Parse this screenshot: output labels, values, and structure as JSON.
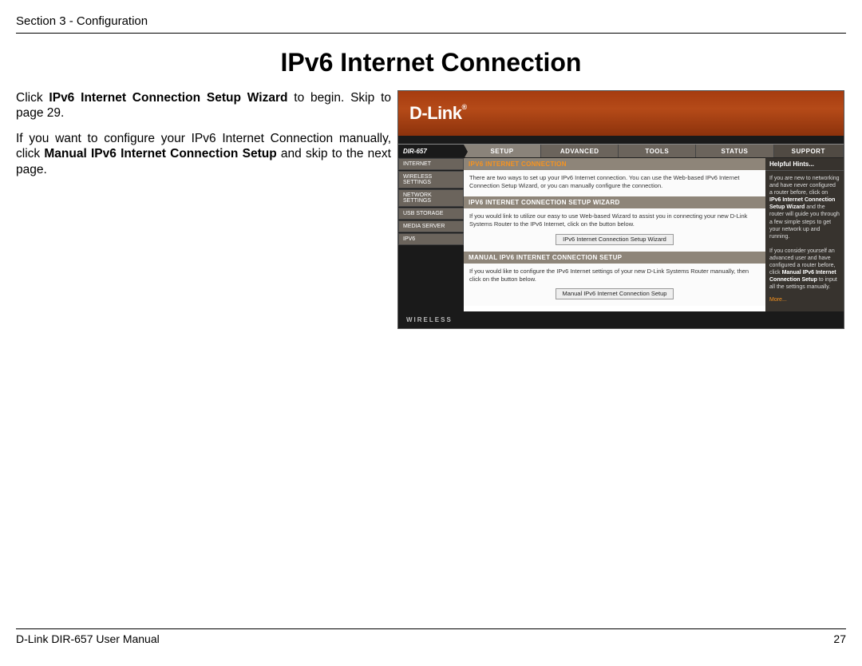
{
  "header": {
    "section": "Section 3 - Configuration"
  },
  "title": "IPv6 Internet Connection",
  "intro": {
    "p1a": "Click ",
    "p1b": "IPv6 Internet Connection Setup Wizard",
    "p1c": " to begin. Skip to page 29.",
    "p2a": "If you want to configure your IPv6 Internet Connection manually, click ",
    "p2b": "Manual IPv6 Internet Connection Setup",
    "p2c": " and skip to the next page."
  },
  "router": {
    "logo": "D-Link",
    "model": "DIR-657",
    "tabs": [
      "SETUP",
      "ADVANCED",
      "TOOLS",
      "STATUS",
      "SUPPORT"
    ],
    "sidebar": [
      "INTERNET",
      "WIRELESS SETTINGS",
      "NETWORK SETTINGS",
      "USB STORAGE",
      "MEDIA SERVER",
      "IPV6"
    ],
    "panel1": {
      "title": "IPV6 INTERNET CONNECTION",
      "text": "There are two ways to set up your IPv6 Internet connection. You can use the Web-based IPv6 Internet Connection Setup Wizard, or you can manually configure the connection."
    },
    "panel2": {
      "title": "IPV6 INTERNET CONNECTION SETUP WIZARD",
      "text": "If you would link to utilize our easy to use Web-based Wizard to assist you in connecting your new D-Link Systems Router to the IPv6 Internet, click on the button below.",
      "button": "IPv6 Internet Connection Setup Wizard"
    },
    "panel3": {
      "title": "MANUAL IPV6 INTERNET CONNECTION SETUP",
      "text": "If you would like to configure the IPv6 Internet settings of your new D-Link Systems Router manually, then click on the button below.",
      "button": "Manual IPv6 Internet Connection Setup"
    },
    "hints": {
      "title": "Helpful Hints...",
      "t1": "If you are new to networking and have never configured a router before, click on ",
      "b1": "IPv6 Internet Connection Setup Wizard",
      "t2": " and the router will guide you through a few simple steps to get your network up and running.",
      "t3": "If you consider yourself an advanced user and have configured a router before, click ",
      "b2": "Manual IPv6 Internet Connection Setup",
      "t4": " to input all the settings manually.",
      "more": "More..."
    },
    "footer": "WIRELESS"
  },
  "footer": {
    "manual": "D-Link DIR-657 User Manual",
    "pageno": "27"
  }
}
